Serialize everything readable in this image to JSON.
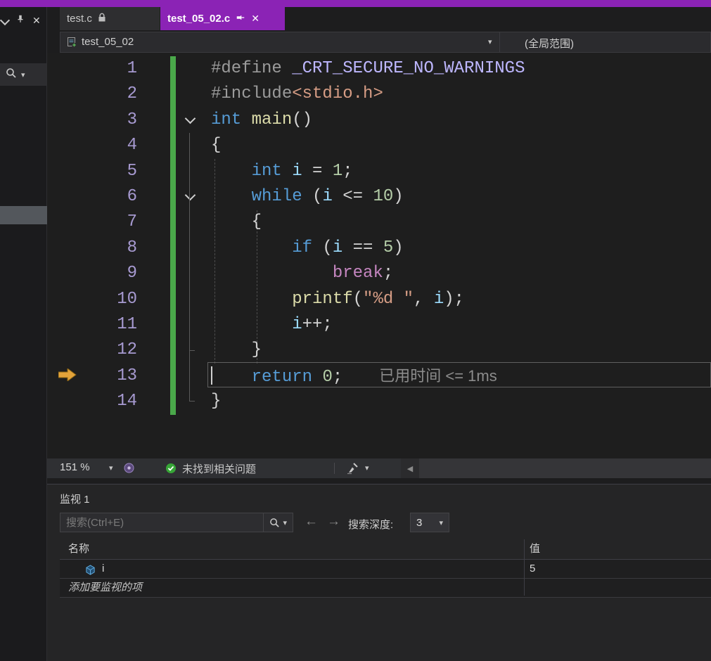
{
  "window": {
    "accent_color": "#8b23b5"
  },
  "icons": {
    "close": "✕",
    "caret_down": "▾",
    "arrow_left": "←",
    "arrow_right": "→",
    "scroll_left": "◀"
  },
  "tabs": [
    {
      "label": "test.c",
      "state_icon": "lock-icon"
    },
    {
      "label": "test_05_02.c",
      "active": true,
      "pin_icon": "pin-icon",
      "close_icon": "✕"
    }
  ],
  "navbar": {
    "project_item": "test_05_02",
    "scope": "(全局范围)"
  },
  "editor": {
    "current_line": 13,
    "perf_tip": "已用时间 <= 1ms",
    "foldable_lines": [
      3,
      6
    ],
    "lines": [
      {
        "num": 1,
        "tokens": [
          {
            "c": "pp",
            "t": "#define "
          },
          {
            "c": "macro",
            "t": "_CRT_SECURE_NO_WARNINGS"
          }
        ]
      },
      {
        "num": 2,
        "tokens": [
          {
            "c": "pp",
            "t": "#include"
          },
          {
            "c": "str",
            "t": "<stdio.h>"
          }
        ]
      },
      {
        "num": 3,
        "tokens": [
          {
            "c": "kw",
            "t": "int"
          },
          {
            "c": "pun",
            "t": " "
          },
          {
            "c": "func",
            "t": "main"
          },
          {
            "c": "pun",
            "t": "()"
          }
        ]
      },
      {
        "num": 4,
        "tokens": [
          {
            "c": "pun",
            "t": "{"
          }
        ]
      },
      {
        "num": 5,
        "tokens": [
          {
            "c": "pun",
            "t": "    "
          },
          {
            "c": "kw",
            "t": "int"
          },
          {
            "c": "pun",
            "t": " "
          },
          {
            "c": "var",
            "t": "i"
          },
          {
            "c": "pun",
            "t": " = "
          },
          {
            "c": "num",
            "t": "1"
          },
          {
            "c": "pun",
            "t": ";"
          }
        ]
      },
      {
        "num": 6,
        "tokens": [
          {
            "c": "pun",
            "t": "    "
          },
          {
            "c": "kw",
            "t": "while"
          },
          {
            "c": "pun",
            "t": " ("
          },
          {
            "c": "var",
            "t": "i"
          },
          {
            "c": "pun",
            "t": " <= "
          },
          {
            "c": "num",
            "t": "10"
          },
          {
            "c": "pun",
            "t": ")"
          }
        ]
      },
      {
        "num": 7,
        "tokens": [
          {
            "c": "pun",
            "t": "    {"
          }
        ]
      },
      {
        "num": 8,
        "tokens": [
          {
            "c": "pun",
            "t": "        "
          },
          {
            "c": "kw",
            "t": "if"
          },
          {
            "c": "pun",
            "t": " ("
          },
          {
            "c": "var",
            "t": "i"
          },
          {
            "c": "pun",
            "t": " == "
          },
          {
            "c": "num",
            "t": "5"
          },
          {
            "c": "pun",
            "t": ")"
          }
        ]
      },
      {
        "num": 9,
        "tokens": [
          {
            "c": "pun",
            "t": "            "
          },
          {
            "c": "brk",
            "t": "break"
          },
          {
            "c": "pun",
            "t": ";"
          }
        ]
      },
      {
        "num": 10,
        "tokens": [
          {
            "c": "pun",
            "t": "        "
          },
          {
            "c": "func",
            "t": "printf"
          },
          {
            "c": "pun",
            "t": "("
          },
          {
            "c": "str",
            "t": "\"%d \""
          },
          {
            "c": "pun",
            "t": ", "
          },
          {
            "c": "var",
            "t": "i"
          },
          {
            "c": "pun",
            "t": ");"
          }
        ]
      },
      {
        "num": 11,
        "tokens": [
          {
            "c": "pun",
            "t": "        "
          },
          {
            "c": "var",
            "t": "i"
          },
          {
            "c": "pun",
            "t": "++;"
          }
        ]
      },
      {
        "num": 12,
        "tokens": [
          {
            "c": "pun",
            "t": "    }"
          }
        ]
      },
      {
        "num": 13,
        "tokens": [
          {
            "c": "pun",
            "t": "    "
          },
          {
            "c": "kw",
            "t": "return"
          },
          {
            "c": "pun",
            "t": " "
          },
          {
            "c": "num",
            "t": "0"
          },
          {
            "c": "pun",
            "t": ";"
          }
        ]
      },
      {
        "num": 14,
        "tokens": [
          {
            "c": "pun",
            "t": "}"
          }
        ]
      }
    ],
    "syntax_colors": {
      "preprocessor": "#9b9b9b",
      "macro": "#beb7ff",
      "keyword": "#569cd6",
      "keyword_control": "#c586c0",
      "function": "#dcdcaa",
      "variable": "#9cdcfe",
      "number": "#b5cea8",
      "string": "#d69d85",
      "default": "#d4d4d4",
      "line_number": "#a79ad1",
      "change_bar": "#4aa84a"
    }
  },
  "statusbar": {
    "zoom": "151 %",
    "health_message": "未找到相关问题",
    "health_status_color": "#37a537"
  },
  "watch": {
    "title": "监视 1",
    "search_placeholder": "搜索(Ctrl+E)",
    "depth_label": "搜索深度:",
    "depth_value": "3",
    "columns": [
      "名称",
      "值"
    ],
    "rows": [
      {
        "name": "i",
        "value": "5"
      }
    ],
    "add_row_label": "添加要监视的项"
  }
}
